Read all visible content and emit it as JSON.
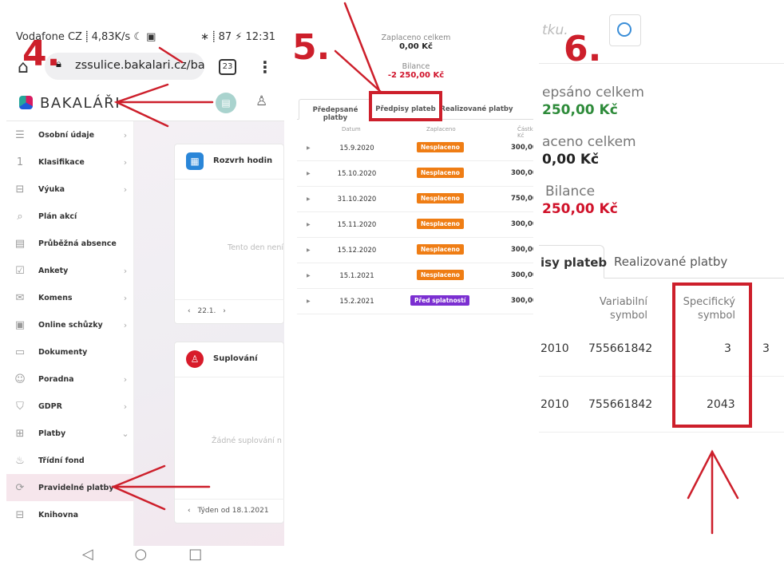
{
  "panel1": {
    "status": {
      "carrier": "Vodafone CZ",
      "speed": "4,83K/s",
      "icons": "☾ ▣",
      "right": "∗ ⸽ 87 ⚡ 12:31"
    },
    "browser": {
      "url": "zssulice.bakalari.cz/ba",
      "tab_count": "23"
    },
    "app": {
      "logo_text": "BAKALÁŘI"
    },
    "sidebar": [
      {
        "label": "Osobní údaje",
        "icon": "id-card-icon",
        "glyph": "☰",
        "chevron": true
      },
      {
        "label": "Klasifikace",
        "icon": "grade-icon",
        "glyph": "1",
        "chevron": true
      },
      {
        "label": "Výuka",
        "icon": "book-icon",
        "glyph": "⊟",
        "chevron": true
      },
      {
        "label": "Plán akcí",
        "icon": "search-person-icon",
        "glyph": "⌕",
        "chevron": false
      },
      {
        "label": "Průběžná absence",
        "icon": "absence-icon",
        "glyph": "▤",
        "chevron": false
      },
      {
        "label": "Ankety",
        "icon": "survey-icon",
        "glyph": "☑",
        "chevron": true
      },
      {
        "label": "Komens",
        "icon": "message-icon",
        "glyph": "✉",
        "chevron": true
      },
      {
        "label": "Online schůzky",
        "icon": "video-meeting-icon",
        "glyph": "▣",
        "chevron": true
      },
      {
        "label": "Dokumenty",
        "icon": "document-icon",
        "glyph": "▭",
        "chevron": false
      },
      {
        "label": "Poradna",
        "icon": "counseling-icon",
        "glyph": "☺",
        "chevron": true
      },
      {
        "label": "GDPR",
        "icon": "shield-icon",
        "glyph": "⛉",
        "chevron": true
      },
      {
        "label": "Platby",
        "icon": "wallet-icon",
        "glyph": "⊞",
        "chevron": "down"
      },
      {
        "label": "Třídní fond",
        "icon": "piggy-bank-icon",
        "glyph": "♨",
        "chevron": false
      },
      {
        "label": "Pravidelné platby",
        "icon": "recurring-payment-icon",
        "glyph": "⟳",
        "chevron": false,
        "active": true
      },
      {
        "label": "Knihovna",
        "icon": "library-icon",
        "glyph": "⊟",
        "chevron": false
      }
    ],
    "cards": {
      "schedule": {
        "title": "Rozvrh hodin",
        "empty": "Tento den není",
        "nav": "22.1."
      },
      "substitutions": {
        "title": "Suplování",
        "empty": "Žádné suplování n",
        "nav": "Týden od 18.1.2021"
      }
    }
  },
  "panel2": {
    "paid_label": "Zaplaceno celkem",
    "paid_value": "0,00 Kč",
    "balance_label": "Bilance",
    "balance_value": "-2 250,00 Kč",
    "tabs": [
      "Předepsané platby",
      "Předpisy plateb",
      "Realizované platby"
    ],
    "columns": [
      "Datum",
      "Zaplaceno",
      "Částka Kč"
    ],
    "rows": [
      {
        "date": "15.9.2020",
        "status": "Nesplaceno",
        "amount": "300,00"
      },
      {
        "date": "15.10.2020",
        "status": "Nesplaceno",
        "amount": "300,00"
      },
      {
        "date": "31.10.2020",
        "status": "Nesplaceno",
        "amount": "750,00"
      },
      {
        "date": "15.11.2020",
        "status": "Nesplaceno",
        "amount": "300,00"
      },
      {
        "date": "15.12.2020",
        "status": "Nesplaceno",
        "amount": "300,00"
      },
      {
        "date": "15.1.2021",
        "status": "Nesplaceno",
        "amount": "300,00"
      },
      {
        "date": "15.2.2021",
        "status": "Před splatností",
        "amount": "300,00"
      }
    ],
    "colors": {
      "unpaid": "#ef7d14",
      "due": "#7b2fd1"
    }
  },
  "panel3": {
    "search_placeholder": "tku.",
    "prescribed_label": "epsáno celkem",
    "prescribed_value": "250,00 Kč",
    "paid_label": "aceno celkem",
    "paid_value": "0,00 Kč",
    "balance_label": "Bilance",
    "balance_value": "250,00 Kč",
    "tabs": [
      "isy plateb",
      "Realizované platby"
    ],
    "col_variable": [
      "Variabilní",
      "symbol"
    ],
    "col_specific": [
      "Specifický",
      "symbol"
    ],
    "rows": [
      {
        "prefix": "2010",
        "variable": "755661842",
        "specific": "3",
        "extra": "3"
      },
      {
        "prefix": "2010",
        "variable": "755661842",
        "specific": "2043",
        "extra": ""
      }
    ]
  },
  "annotations": {
    "step4": "4.",
    "step5": "5.",
    "step6": "6.",
    "accent": "#cd1f2b"
  }
}
